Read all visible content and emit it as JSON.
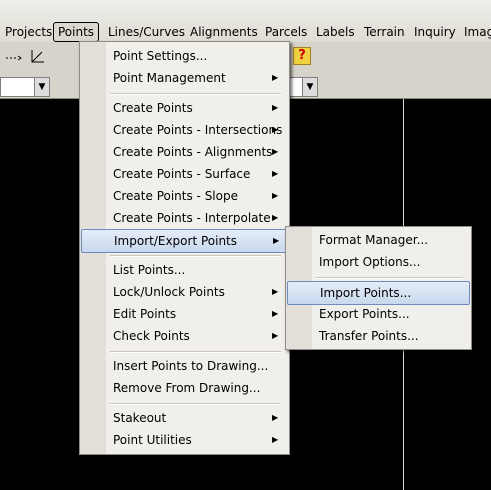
{
  "menubar": {
    "items": [
      "Projects",
      "Points",
      "Lines/Curves",
      "Alignments",
      "Parcels",
      "Labels",
      "Terrain",
      "Inquiry",
      "Image"
    ]
  },
  "toolbar": {
    "tools": [
      "dotted-line-icon",
      "angle-icon",
      "help-icon"
    ],
    "arrow_glyph": "▼"
  },
  "points_menu": {
    "groups": [
      [
        {
          "label": "Point Settings...",
          "submenu": false
        },
        {
          "label": "Point Management",
          "submenu": true
        }
      ],
      [
        {
          "label": "Create Points",
          "submenu": true
        },
        {
          "label": "Create Points - Intersections",
          "submenu": true
        },
        {
          "label": "Create Points - Alignments",
          "submenu": true
        },
        {
          "label": "Create Points - Surface",
          "submenu": true
        },
        {
          "label": "Create Points - Slope",
          "submenu": true
        },
        {
          "label": "Create Points - Interpolate",
          "submenu": true
        },
        {
          "label": "Import/Export Points",
          "submenu": true,
          "highlighted": true
        }
      ],
      [
        {
          "label": "List Points...",
          "submenu": false
        },
        {
          "label": "Lock/Unlock Points",
          "submenu": true
        },
        {
          "label": "Edit Points",
          "submenu": true
        },
        {
          "label": "Check Points",
          "submenu": true
        }
      ],
      [
        {
          "label": "Insert Points to Drawing...",
          "submenu": false
        },
        {
          "label": "Remove From Drawing...",
          "submenu": false
        }
      ],
      [
        {
          "label": "Stakeout",
          "submenu": true
        },
        {
          "label": "Point Utilities",
          "submenu": true
        }
      ]
    ]
  },
  "import_export_submenu": {
    "groups": [
      [
        {
          "label": "Format Manager..."
        },
        {
          "label": "Import Options..."
        }
      ],
      [
        {
          "label": "Import Points...",
          "highlighted": true
        },
        {
          "label": "Export Points..."
        },
        {
          "label": "Transfer Points..."
        }
      ]
    ]
  },
  "glyphs": {
    "submenu_arrow": "▶"
  }
}
